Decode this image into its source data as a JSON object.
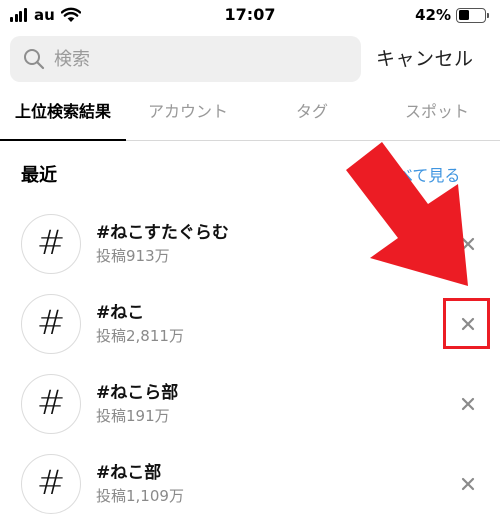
{
  "status_bar": {
    "carrier": "au",
    "time": "17:07",
    "battery_percent_label": "42%",
    "battery_level": 0.42
  },
  "search": {
    "placeholder": "検索",
    "value": "",
    "cancel_label": "キャンセル"
  },
  "tabs": [
    {
      "label": "上位検索結果",
      "active": true
    },
    {
      "label": "アカウント",
      "active": false
    },
    {
      "label": "タグ",
      "active": false
    },
    {
      "label": "スポット",
      "active": false
    }
  ],
  "recent": {
    "title": "最近",
    "see_all_label": "べて見る",
    "items": [
      {
        "tag": "#ねこすたぐらむ",
        "posts": "投稿913万",
        "icon": "hashtag-icon"
      },
      {
        "tag": "#ねこ",
        "posts": "投稿2,811万",
        "icon": "hashtag-icon"
      },
      {
        "tag": "#ねこら部",
        "posts": "投稿191万",
        "icon": "hashtag-icon"
      },
      {
        "tag": "#ねこ部",
        "posts": "投稿1,109万",
        "icon": "hashtag-icon"
      }
    ]
  },
  "annotation": {
    "arrow_color": "#ec1c24",
    "highlight_color": "#ec1c24"
  },
  "colors": {
    "link": "#3f95e0",
    "secondary_text": "#8a8a8a",
    "search_bg": "#efefef"
  }
}
